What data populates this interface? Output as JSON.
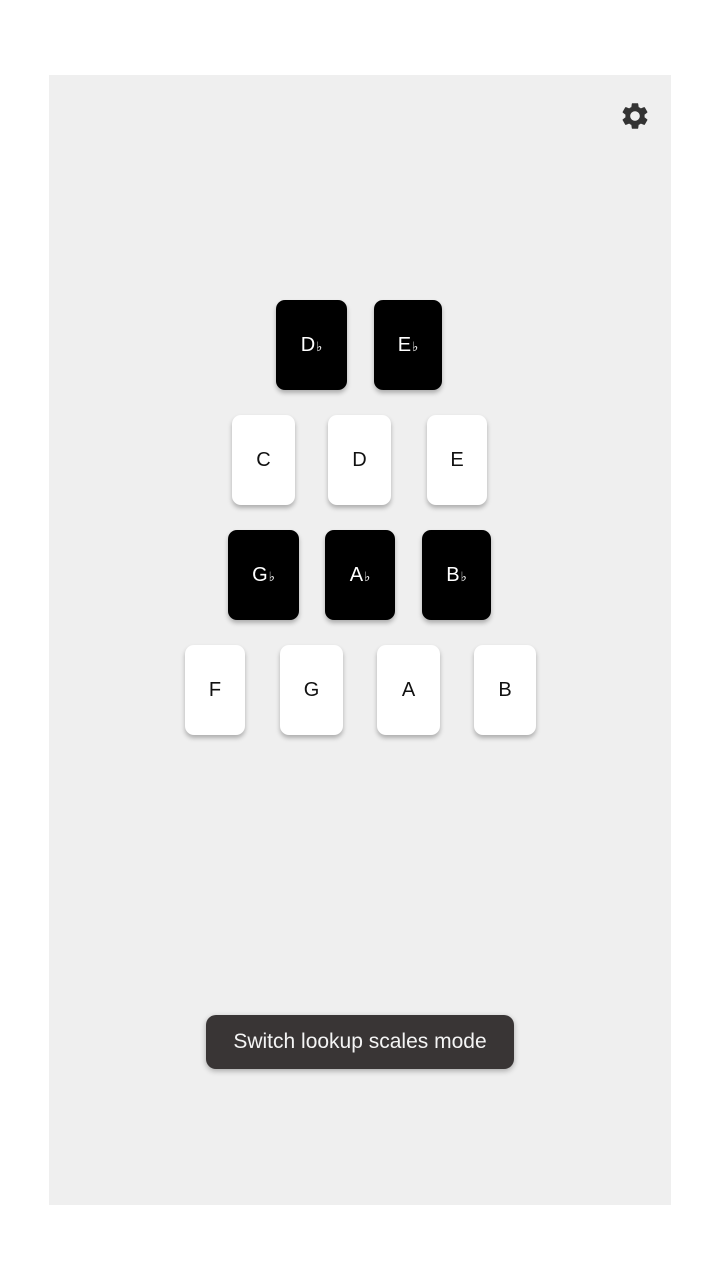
{
  "settings": {
    "icon": "gear-icon",
    "icon_color": "#333333"
  },
  "keys": {
    "db": {
      "letter": "D",
      "accidental": "♭"
    },
    "eb": {
      "letter": "E",
      "accidental": "♭"
    },
    "c": {
      "letter": "C"
    },
    "d": {
      "letter": "D"
    },
    "e": {
      "letter": "E"
    },
    "gb": {
      "letter": "G",
      "accidental": "♭"
    },
    "ab": {
      "letter": "A",
      "accidental": "♭"
    },
    "bb": {
      "letter": "B",
      "accidental": "♭"
    },
    "f": {
      "letter": "F"
    },
    "g": {
      "letter": "G"
    },
    "a": {
      "letter": "A"
    },
    "b": {
      "letter": "B"
    }
  },
  "toast": {
    "message": "Switch lookup scales mode"
  },
  "colors": {
    "panel_background": "#efefef",
    "white_key": "#ffffff",
    "black_key": "#000000",
    "toast_background": "#393535"
  }
}
